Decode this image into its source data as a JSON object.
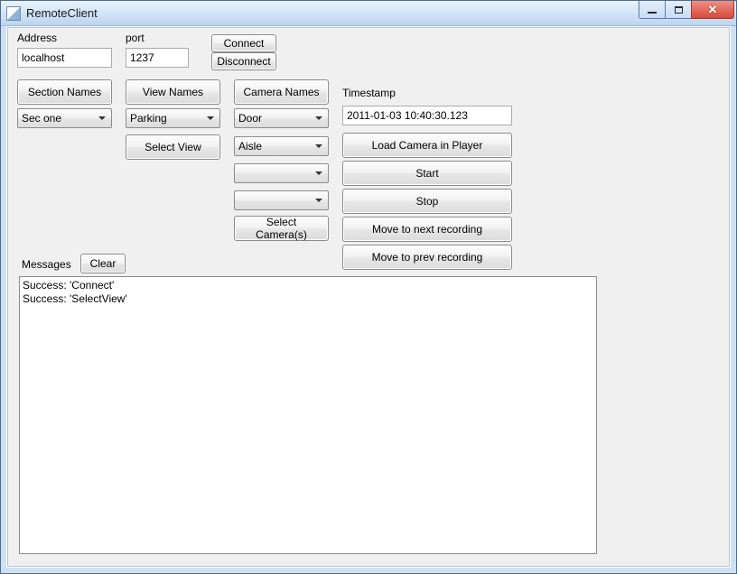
{
  "window": {
    "title": "RemoteClient"
  },
  "labels": {
    "address": "Address",
    "port": "port",
    "timestamp": "Timestamp",
    "messages": "Messages"
  },
  "inputs": {
    "address_value": "localhost",
    "port_value": "1237",
    "timestamp_value": "2011-01-03 10:40:30.123"
  },
  "buttons": {
    "connect": "Connect",
    "disconnect": "Disconnect",
    "section_names": "Section Names",
    "view_names": "View Names",
    "camera_names": "Camera Names",
    "select_view": "Select View",
    "select_cameras": "Select Camera(s)",
    "load_camera": "Load Camera in Player",
    "start": "Start",
    "stop": "Stop",
    "move_next": "Move to next recording",
    "move_prev": "Move to prev recording",
    "clear": "Clear"
  },
  "combos": {
    "section": "Sec one",
    "view": "Parking",
    "camera1": "Door",
    "camera2": "Aisle",
    "camera3": "",
    "camera4": ""
  },
  "messages": "Success: 'Connect'\nSuccess: 'SelectView'"
}
